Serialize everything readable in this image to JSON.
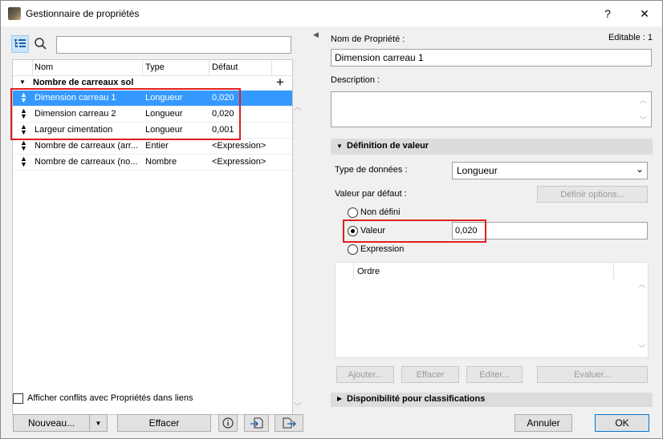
{
  "window": {
    "title": "Gestionnaire de propriétés",
    "help_glyph": "?",
    "close_glyph": "✕"
  },
  "left": {
    "search": {
      "value": "",
      "placeholder": ""
    },
    "columns": [
      "Nom",
      "Type",
      "Défaut"
    ],
    "group": {
      "label": "Nombre de carreaux sol",
      "add_glyph": "+"
    },
    "rows": [
      {
        "name": "Dimension carreau 1",
        "type": "Longueur",
        "default": "0,020",
        "selected": true
      },
      {
        "name": "Dimension carreau 2",
        "type": "Longueur",
        "default": "0,020",
        "selected": false
      },
      {
        "name": "Largeur cimentation",
        "type": "Longueur",
        "default": "0,001",
        "selected": false
      },
      {
        "name": "Nombre de carreaux (arr...",
        "type": "Entier",
        "default": "<Expression>",
        "selected": false
      },
      {
        "name": "Nombre de carreaux (no...",
        "type": "Nombre",
        "default": "<Expression>",
        "selected": false
      }
    ],
    "show_conflicts_label": "Afficher conflits avec Propriétés dans liens",
    "show_conflicts_checked": false,
    "new_button": "Nouveau...",
    "delete_button": "Effacer"
  },
  "right": {
    "property_name_label": "Nom de Propriété :",
    "editable_label": "Editable : 1",
    "property_name_value": "Dimension carreau 1",
    "description_label": "Description :",
    "description_value": "",
    "value_definition_header": "Définition de valeur",
    "data_type_label": "Type de données :",
    "data_type_value": "Longueur",
    "default_value_label": "Valeur par défaut :",
    "define_options_button": "Définir options...",
    "radio_undefined": "Non défini",
    "radio_value": "Valeur",
    "radio_expression": "Expression",
    "selected_radio": "value",
    "value_field": "0,020",
    "order_column": "Ordre",
    "add_button": "Ajouter...",
    "delete_button": "Effacer",
    "edit_button": "Editer...",
    "evaluate_button": "Evaluer...",
    "availability_header": "Disponibilité pour classifications",
    "cancel_button": "Annuler",
    "ok_button": "OK"
  },
  "colors": {
    "selection": "#3399ff",
    "highlight_box": "#e02020",
    "primary_border": "#0078d7"
  }
}
